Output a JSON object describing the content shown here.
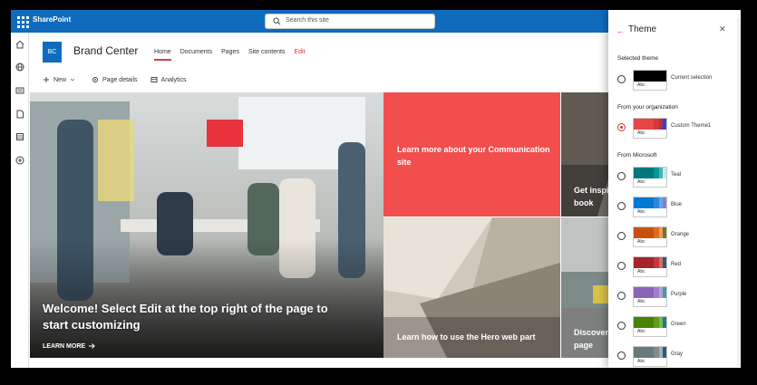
{
  "suite": {
    "app_name": "SharePoint",
    "search_placeholder": "Search this site"
  },
  "site": {
    "logo_text": "BC",
    "title": "Brand Center",
    "nav": [
      "Home",
      "Documents",
      "Pages",
      "Site contents"
    ],
    "edit_label": "Edit"
  },
  "commands": {
    "new": "New",
    "page_details": "Page details",
    "analytics": "Analytics"
  },
  "hero": {
    "main_caption": "Welcome! Select Edit at the top right of the page to start customizing",
    "learn_more": "LEARN MORE",
    "red_caption": "Learn more about your Communication site",
    "arch_caption": "Learn how to use the Hero web part",
    "r1_caption": "Get inspir\nbook",
    "r2_caption": "Discover w\npage"
  },
  "panel": {
    "title": "Theme",
    "selected_heading": "Selected theme",
    "org_heading": "From your organization",
    "ms_heading": "From Microsoft",
    "swatch_text": "Abc",
    "current": {
      "name": "Current selection",
      "colors": [
        "#000000",
        "#000000",
        "#000000",
        "#000000"
      ]
    },
    "org": {
      "name": "Custom Theme1",
      "colors": [
        "#e84545",
        "#d63a3a",
        "#b22f55",
        "#3b3bd6"
      ]
    },
    "microsoft": [
      {
        "name": "Teal",
        "colors": [
          "#03787c",
          "#05979b",
          "#43b5b8",
          "#c8e8e8"
        ]
      },
      {
        "name": "Blue",
        "colors": [
          "#0078d4",
          "#2b88d8",
          "#60a8e8",
          "#8c7ad6"
        ]
      },
      {
        "name": "Orange",
        "colors": [
          "#ca5010",
          "#e06a20",
          "#f09a5a",
          "#6b7a2a"
        ]
      },
      {
        "name": "Red",
        "colors": [
          "#a4262c",
          "#c4383e",
          "#d96a6e",
          "#2f5a7a"
        ]
      },
      {
        "name": "Purple",
        "colors": [
          "#8764b8",
          "#9f80c8",
          "#b8a0d8",
          "#3aa0a0"
        ]
      },
      {
        "name": "Green",
        "colors": [
          "#498205",
          "#5d9e1a",
          "#7cb84a",
          "#1e7a8c"
        ]
      },
      {
        "name": "Gray",
        "colors": [
          "#69797e",
          "#7e8c90",
          "#a0acb0",
          "#2d5b78"
        ]
      }
    ]
  }
}
